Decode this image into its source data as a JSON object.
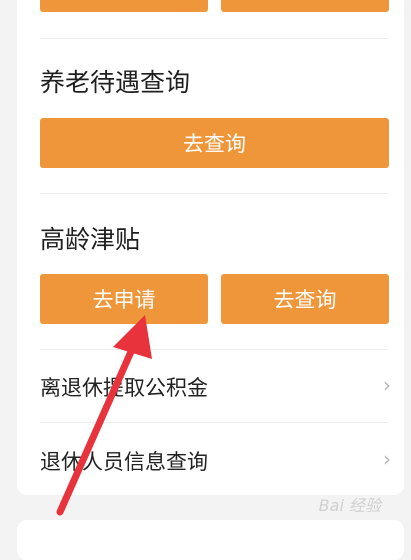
{
  "sections": {
    "pension": {
      "title": "养老待遇查询",
      "query_label": "去查询"
    },
    "elderly_allowance": {
      "title": "高龄津贴",
      "apply_label": "去申请",
      "query_label": "去查询"
    }
  },
  "list_items": [
    {
      "label": "离退休提取公积金",
      "chevron": "›"
    },
    {
      "label": "退休人员信息查询",
      "chevron": "›"
    }
  ],
  "watermark": "Bai 经验",
  "colors": {
    "accent": "#f0963a",
    "annotation_arrow": "#e8323c"
  }
}
